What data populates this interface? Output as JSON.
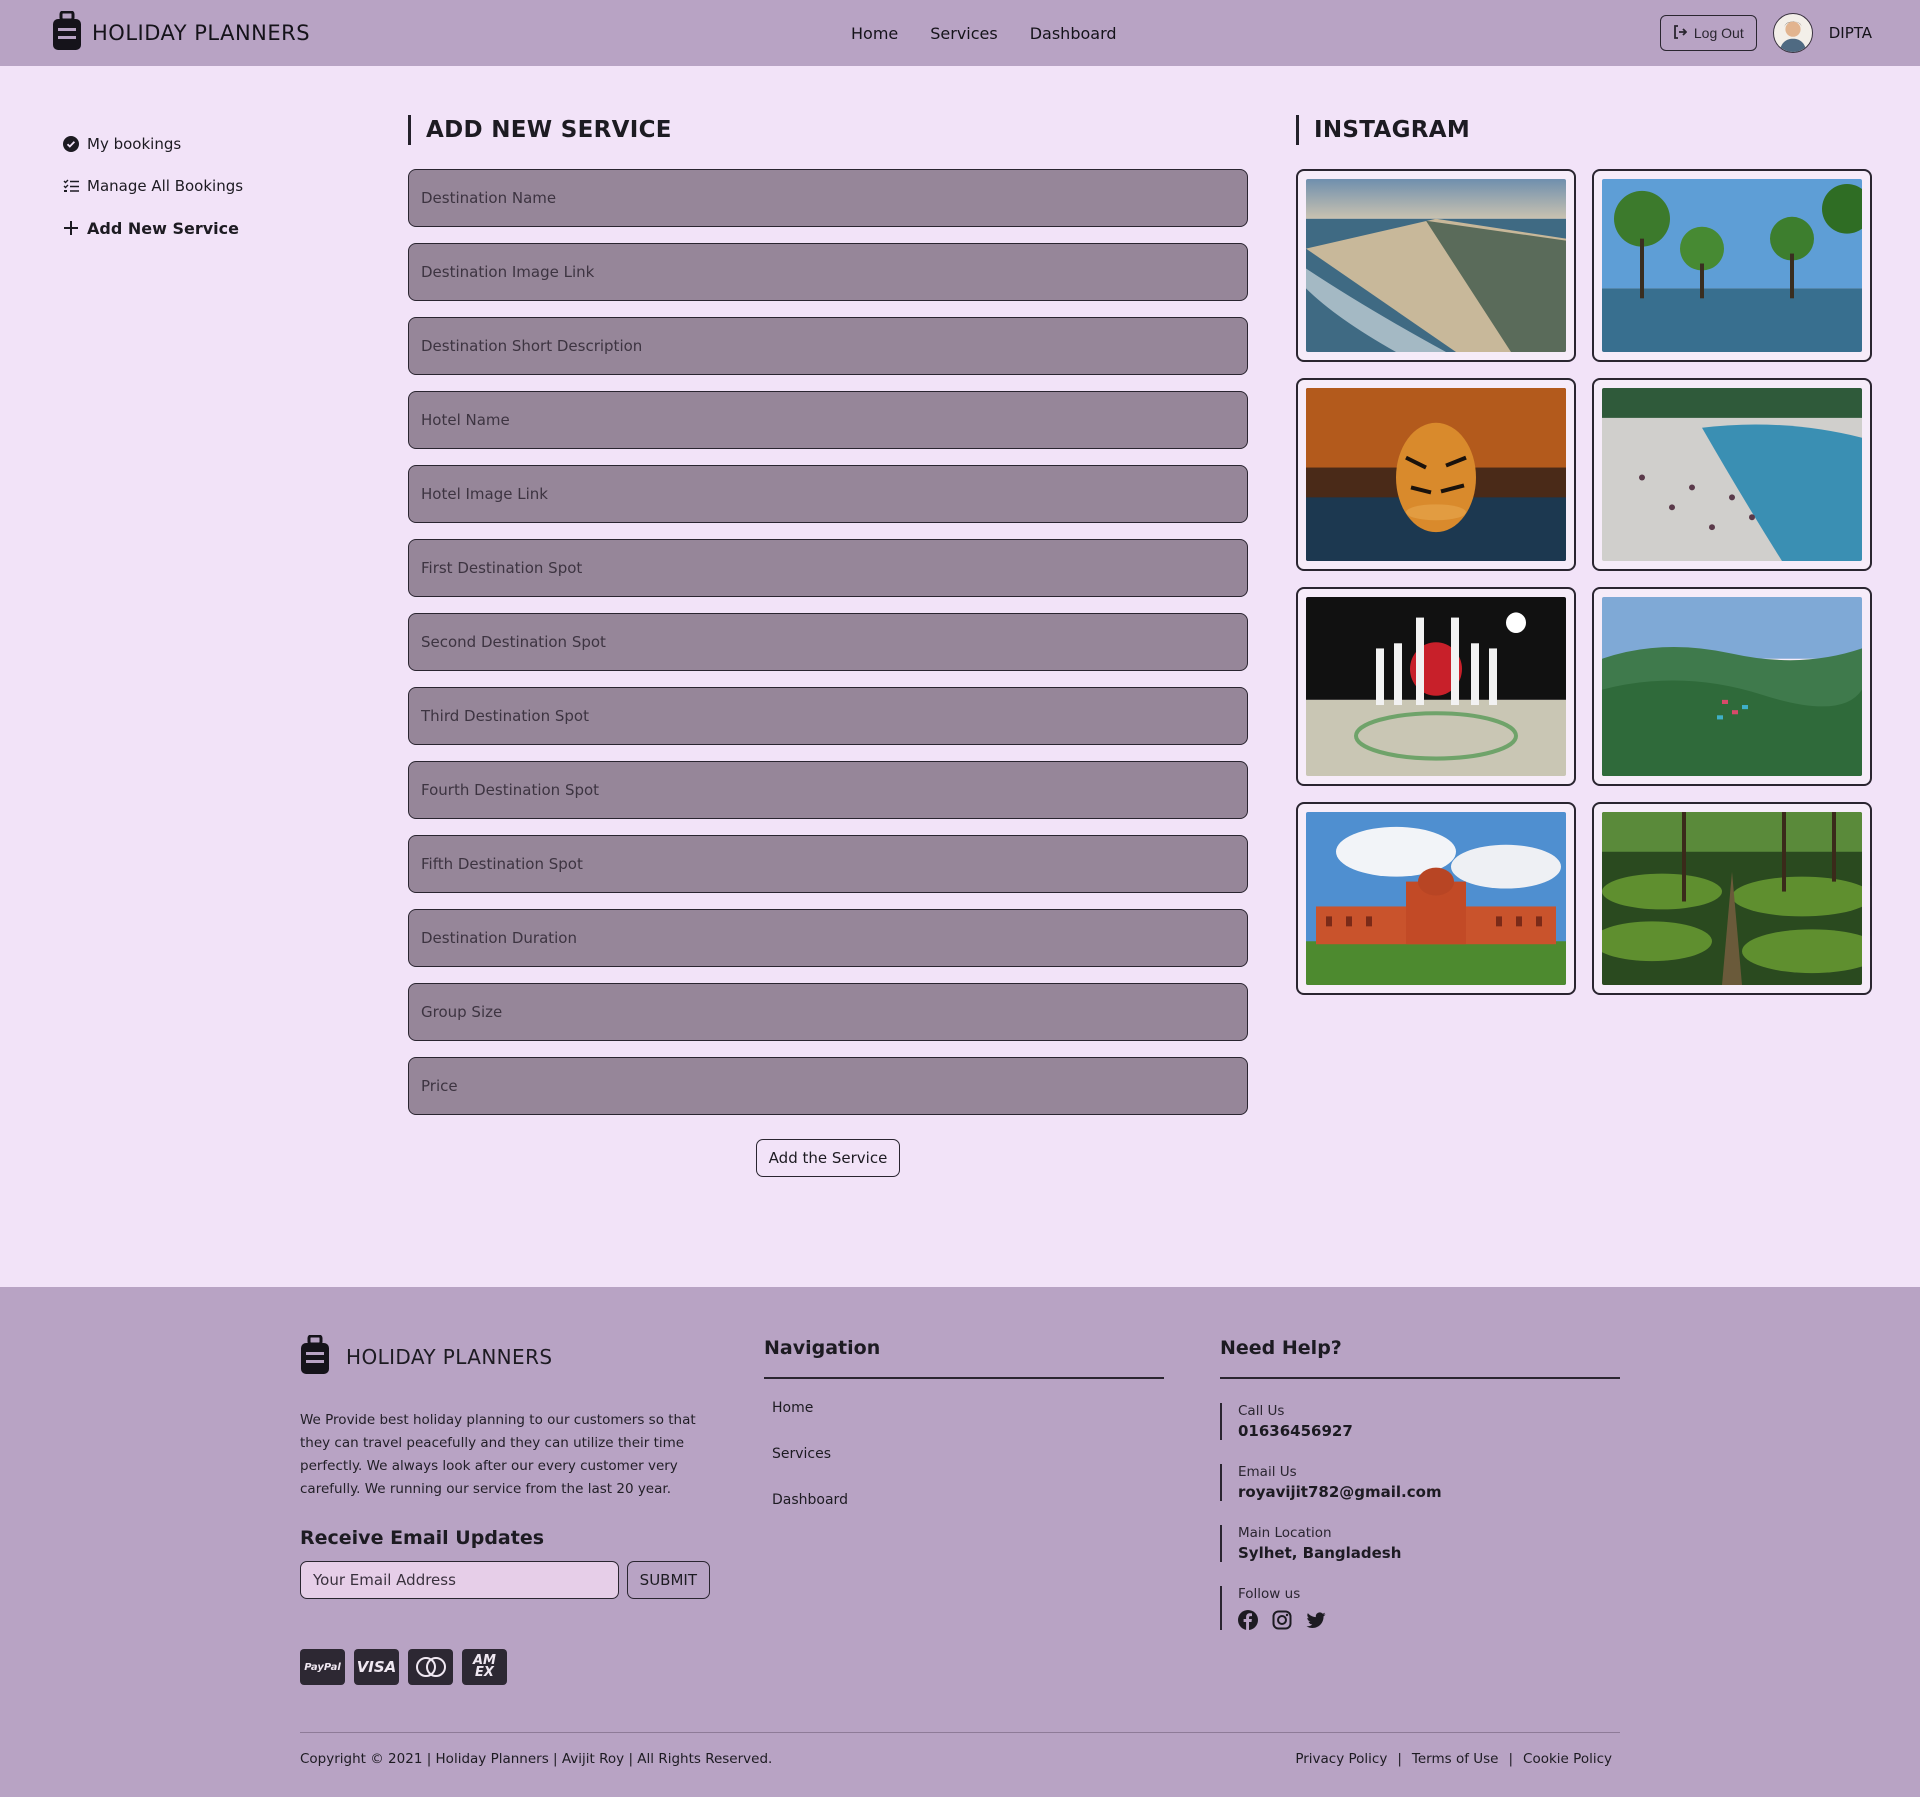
{
  "header": {
    "brand": "HOLIDAY PLANNERS",
    "nav": [
      "Home",
      "Services",
      "Dashboard"
    ],
    "logout_label": "Log Out",
    "username": "DIPTA"
  },
  "sidebar": {
    "items": [
      {
        "label": "My bookings",
        "icon": "check-circle-icon"
      },
      {
        "label": "Manage All Bookings",
        "icon": "list-check-icon"
      },
      {
        "label": "Add New Service",
        "icon": "plus-icon"
      }
    ]
  },
  "form": {
    "title": "ADD NEW SERVICE",
    "fields": [
      "Destination Name",
      "Destination Image Link",
      "Destination Short Description",
      "Hotel Name",
      "Hotel Image Link",
      "First Destination Spot",
      "Second Destination Spot",
      "Third Destination Spot",
      "Fourth Destination Spot",
      "Fifth Destination Spot",
      "Destination Duration",
      "Group Size",
      "Price"
    ],
    "submit_label": "Add the Service"
  },
  "instagram": {
    "title": "INSTAGRAM",
    "photos": [
      "beach-aerial-photo",
      "mangrove-trees-photo",
      "tiger-photo",
      "river-crowd-photo",
      "monument-photo",
      "hills-aerial-photo",
      "red-building-photo",
      "tea-garden-photo"
    ]
  },
  "footer": {
    "brand": "HOLIDAY PLANNERS",
    "description": "We Provide best holiday planning to our customers so that they can travel peacefully and they can utilize their time perfectly. We always look after our every customer very carefully. We running our service from the last 20 year.",
    "subscribe_title": "Receive Email Updates",
    "email_placeholder": "Your Email Address",
    "submit_label": "SUBMIT",
    "payments": [
      "PayPal",
      "VISA",
      "",
      "AM EX"
    ],
    "navigation_title": "Navigation",
    "navigation_links": [
      "Home",
      "Services",
      "Dashboard"
    ],
    "help_title": "Need Help?",
    "help": [
      {
        "label": "Call Us",
        "value": "01636456927"
      },
      {
        "label": "Email Us",
        "value": "royavijit782@gmail.com"
      },
      {
        "label": "Main Location",
        "value": "Sylhet, Bangladesh"
      }
    ],
    "follow_label": "Follow us",
    "socials": [
      "facebook-icon",
      "instagram-icon",
      "twitter-icon"
    ],
    "copyright": "Copyright © 2021 | Holiday Planners | Avijit Roy | All Rights Reserved.",
    "policies": [
      "Privacy Policy",
      "Terms of Use",
      "Cookie Policy"
    ]
  }
}
